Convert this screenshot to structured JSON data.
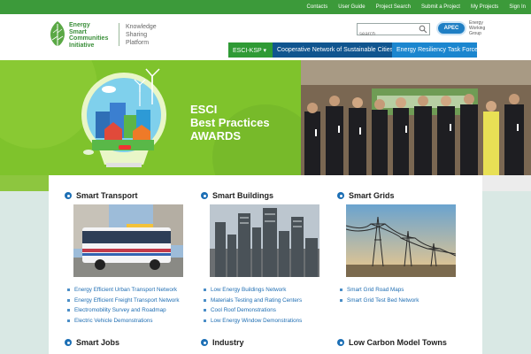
{
  "topbar": {
    "links": [
      "Contacts",
      "User Guide",
      "Project Search",
      "Submit a Project",
      "My Projects",
      "Sign In"
    ]
  },
  "header": {
    "logo_lines": [
      "Energy",
      "Smart",
      "Communities",
      "Initiative"
    ],
    "ksp_lines": [
      "Knowledge",
      "Sharing",
      "Platform"
    ],
    "search_placeholder": "search",
    "apec_label": "APEC",
    "ewg_lines": [
      "Energy",
      "Working",
      "Group"
    ],
    "nav": [
      "ESCI-KSP ▾",
      "Cooperative Network of Sustainable Cities",
      "Energy Resiliency Task Force"
    ]
  },
  "hero": {
    "title_lines": [
      "ESCI",
      "Best Practices",
      "AWARDS"
    ]
  },
  "cards": [
    {
      "title": "Smart Transport",
      "image": "bus-photo",
      "links": [
        "Energy Efficient Urban Transport Network",
        "Energy Efficient Freight Transport Network",
        "Electromobility Survey and Roadmap",
        "Electric Vehicle Demonstrations"
      ]
    },
    {
      "title": "Smart Buildings",
      "image": "city-photo",
      "links": [
        "Low Energy Buildings Network",
        "Materials Testing and Rating Centers",
        "Cool Roof Demonstrations",
        "Low Energy Window Demonstrations"
      ]
    },
    {
      "title": "Smart Grids",
      "image": "power-lines-photo",
      "links": [
        "Smart Grid Road Maps",
        "Smart Grid Test Bed Network"
      ]
    }
  ],
  "row2": [
    "Smart Jobs",
    "Industry",
    "Low Carbon Model Towns"
  ],
  "colors": {
    "topbar": "#3c9a3a",
    "link": "#1f6eb3",
    "accent_green": "#8dc63f",
    "nav_dark_blue": "#10558f",
    "nav_light_blue": "#1b86cf"
  }
}
